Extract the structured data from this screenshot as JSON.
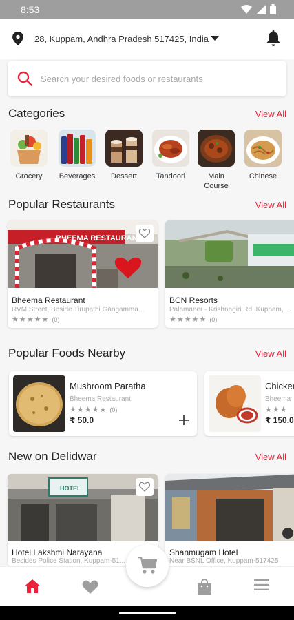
{
  "status_bar": {
    "time": "8:53"
  },
  "location": {
    "text": "28, Kuppam, Andhra Pradesh 517425, India"
  },
  "search": {
    "placeholder": "Search your desired foods or restaurants"
  },
  "categories": {
    "title": "Categories",
    "view_all": "View All",
    "items": [
      {
        "label": "Grocery"
      },
      {
        "label": "Beverages"
      },
      {
        "label": "Dessert"
      },
      {
        "label": "Tandoori"
      },
      {
        "label": "Main Course"
      },
      {
        "label": "Chinese"
      }
    ]
  },
  "popular_restaurants": {
    "title": "Popular Restaurants",
    "view_all": "View All",
    "items": [
      {
        "name": "Bheema Restaurant",
        "address": "RVM Street, Beside Tirupathi Gangamma...",
        "stars": "★★★★★",
        "count": "(0)",
        "sign_text": "BHEEMA RESTAURANT"
      },
      {
        "name": "BCN Resorts",
        "address": "Palamaner - Krishnagiri Rd, Kuppam, ...",
        "stars": "★★★★★",
        "count": "(0)"
      }
    ]
  },
  "popular_foods": {
    "title": "Popular Foods Nearby",
    "view_all": "View All",
    "items": [
      {
        "name": "Mushroom Paratha",
        "restaurant": "Bheema Restaurant",
        "stars": "★★★★★",
        "count": "(0)",
        "price": "₹ 50.0"
      },
      {
        "name": "Chicken",
        "restaurant": "Bheema",
        "stars": "★★★",
        "count": "",
        "price": "₹ 150.0"
      }
    ]
  },
  "new_on": {
    "title": "New on Delidwar",
    "view_all": "View All",
    "items": [
      {
        "name": "Hotel Lakshmi Narayana",
        "address": "Besides Police Station, Kuppam-51...",
        "sign_text": "HOTEL"
      },
      {
        "name": "Shanmugam Hotel",
        "address": "Near BSNL Office, Kuppam-517425"
      }
    ]
  },
  "colors": {
    "accent": "#e8233a",
    "nav_inactive": "#9e9e9e",
    "stars": "#9a9a9a"
  },
  "nav": {
    "items": [
      {
        "icon": "home-icon",
        "active": true
      },
      {
        "icon": "heart-icon",
        "active": false
      },
      {
        "icon": "cart-icon",
        "active": false
      },
      {
        "icon": "shopping-bag-icon",
        "active": false
      },
      {
        "icon": "menu-icon",
        "active": false
      }
    ]
  }
}
